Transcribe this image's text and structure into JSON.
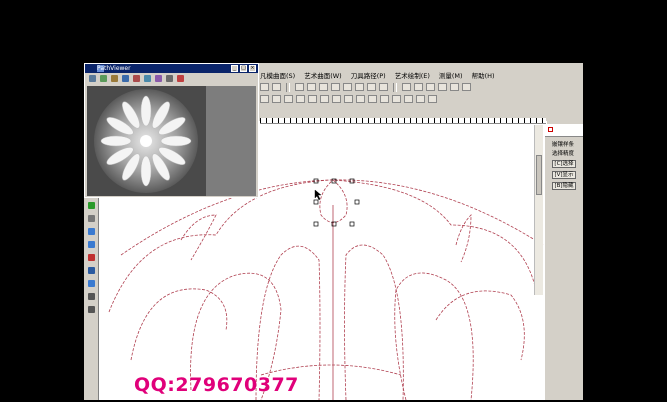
{
  "menu": {
    "items": [
      "凡模曲面(S)",
      "艺术曲面(W)",
      "刀具路径(P)",
      "艺术绘制(E)",
      "测量(M)",
      "帮助(H)"
    ]
  },
  "panel": {
    "labels": [
      "嵌镶样条",
      "选择精度"
    ],
    "buttons": [
      "[C]选择",
      "[V]显示",
      "[B]隐藏"
    ]
  },
  "preview_window": {
    "title": "PathViewer",
    "buttons": [
      "_",
      "□",
      "×"
    ]
  },
  "watermark": {
    "text": "QQ:279670377",
    "color": "#e0007a"
  },
  "colors": {
    "curve": "#b04050",
    "titlebar": "#0a246a",
    "chrome": "#d4d0c8"
  },
  "icons": [
    "window-icon",
    "open-icon",
    "zoom-icon",
    "pan-icon",
    "rotate-icon",
    "render-icon",
    "help-icon",
    "select-icon",
    "node-icon"
  ]
}
